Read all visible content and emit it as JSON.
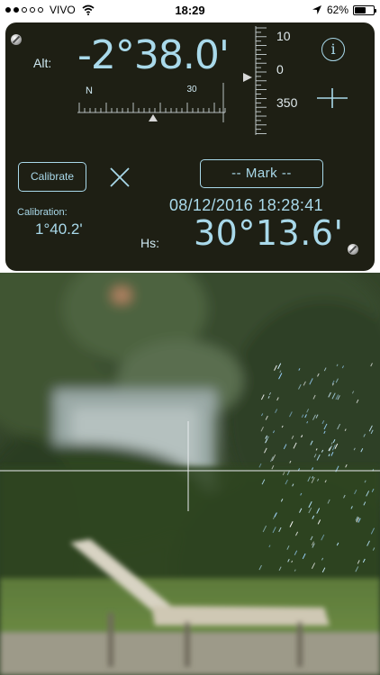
{
  "status_bar": {
    "carrier": "VIVO",
    "time": "18:29",
    "battery_percent": "62%",
    "signal_bars_filled": 2,
    "signal_bars_total": 5
  },
  "panel": {
    "alt_label": "Alt:",
    "alt_value": "-2°38.0'",
    "compass": {
      "north_label": "N",
      "tick_label": "30"
    },
    "scale": {
      "labels": [
        "10",
        "0",
        "350"
      ]
    },
    "info_label": "i",
    "calibrate_label": "Calibrate",
    "mark_label": "-- Mark --",
    "calibration_label": "Calibration:",
    "calibration_value": "1°40.2'",
    "timestamp": "08/12/2016 18:28:41",
    "hs_label": "Hs:",
    "hs_value": "30°13.6'"
  },
  "colors": {
    "panel_bg": "#1e1f14",
    "accent": "#a9d9ea"
  }
}
